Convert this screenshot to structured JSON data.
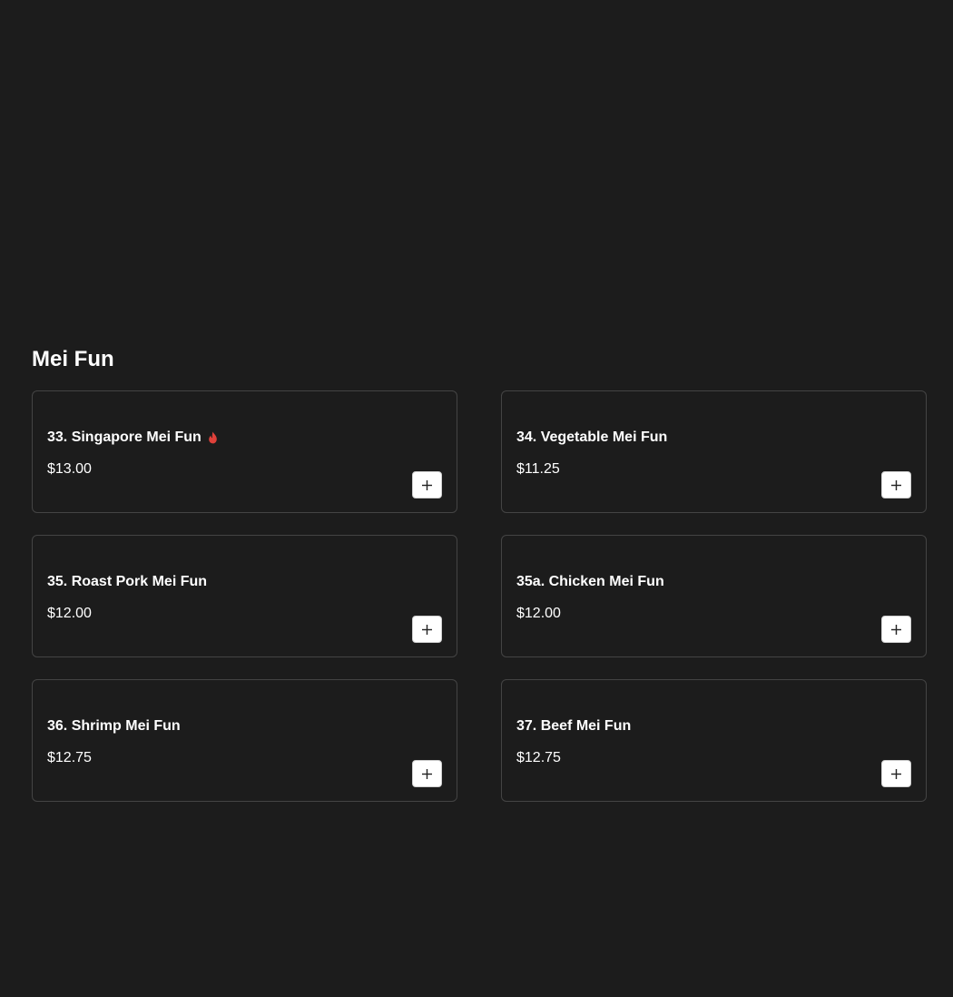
{
  "section": {
    "title": "Mei Fun"
  },
  "items": [
    {
      "name": "33. Singapore Mei Fun",
      "price": "$13.00",
      "spicy": true
    },
    {
      "name": "34. Vegetable Mei Fun",
      "price": "$11.25",
      "spicy": false
    },
    {
      "name": "35. Roast Pork Mei Fun",
      "price": "$12.00",
      "spicy": false
    },
    {
      "name": "35a. Chicken Mei Fun",
      "price": "$12.00",
      "spicy": false
    },
    {
      "name": "36. Shrimp Mei Fun",
      "price": "$12.75",
      "spicy": false
    },
    {
      "name": "37. Beef Mei Fun",
      "price": "$12.75",
      "spicy": false
    }
  ],
  "colors": {
    "background": "#1c1c1c",
    "card_border": "#444444",
    "text": "#ffffff",
    "spicy": "#e0413a",
    "button_bg": "#ffffff"
  },
  "icons": {
    "spicy": "flame-icon",
    "add": "plus-icon"
  }
}
